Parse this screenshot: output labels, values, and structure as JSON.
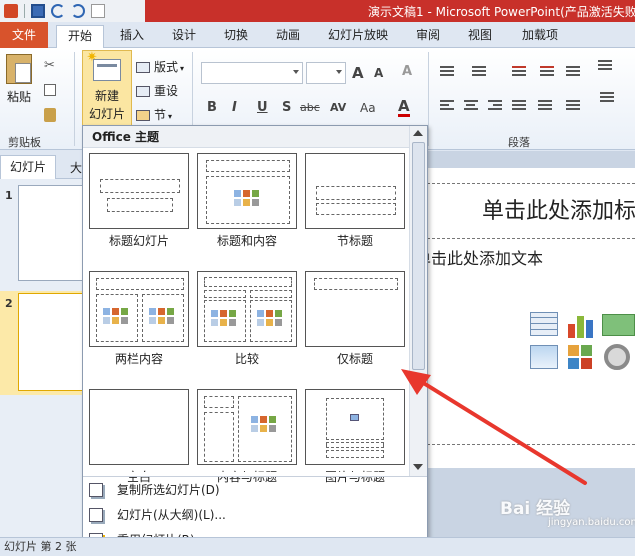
{
  "window": {
    "title": "演示文稿1 - Microsoft PowerPoint(产品激活失败"
  },
  "ribbon_tabs": [
    {
      "label": "文件",
      "active": false
    },
    {
      "label": "开始",
      "active": true
    },
    {
      "label": "插入",
      "active": false
    },
    {
      "label": "设计",
      "active": false
    },
    {
      "label": "切换",
      "active": false
    },
    {
      "label": "动画",
      "active": false
    },
    {
      "label": "幻灯片放映",
      "active": false
    },
    {
      "label": "审阅",
      "active": false
    },
    {
      "label": "视图",
      "active": false
    },
    {
      "label": "加载项",
      "active": false
    }
  ],
  "ribbon": {
    "paste_label": "粘贴",
    "clipboard_group": "剪贴板",
    "new_slide_line1": "新建",
    "new_slide_line2": "幻灯片",
    "layout_label": "版式",
    "reset_label": "重设",
    "section_label": "节",
    "paragraph_group": "段落",
    "font_grow": "A",
    "font_shrink": "A",
    "clear_format": "A",
    "bold": "B",
    "italic": "I",
    "underline": "U",
    "shadow": "S",
    "strike": "abc",
    "spacing": "AV",
    "case": "Aa",
    "font_color": "A"
  },
  "left_panel": {
    "tab_slides": "幻灯片",
    "tab_outline": "大",
    "slides": [
      {
        "number": "1"
      },
      {
        "number": "2",
        "selected": true
      }
    ]
  },
  "slide": {
    "title_placeholder": "单击此处添加标",
    "body_placeholder": "单击此处添加文本"
  },
  "gallery": {
    "header": "Office 主题",
    "layouts": [
      {
        "label": "标题幻灯片"
      },
      {
        "label": "标题和内容"
      },
      {
        "label": "节标题"
      },
      {
        "label": "两栏内容"
      },
      {
        "label": "比较"
      },
      {
        "label": "仅标题"
      },
      {
        "label": "空白"
      },
      {
        "label": "内容与标题"
      },
      {
        "label": "图片与标题"
      }
    ],
    "menu": [
      {
        "label": "复制所选幻灯片(D)"
      },
      {
        "label": "幻灯片(从大纲)(L)..."
      },
      {
        "label": "重用幻灯片(R)..."
      }
    ]
  },
  "status": {
    "text": "幻灯片 第 2 张"
  },
  "watermark": {
    "text": "Bai 经验",
    "sub": "jingyan.baidu.com"
  },
  "colors": {
    "title_bar": "#c8302a",
    "file_tab": "#d8532c",
    "arrow": "#e8372d",
    "selected_thumb": "#fce9a8"
  }
}
